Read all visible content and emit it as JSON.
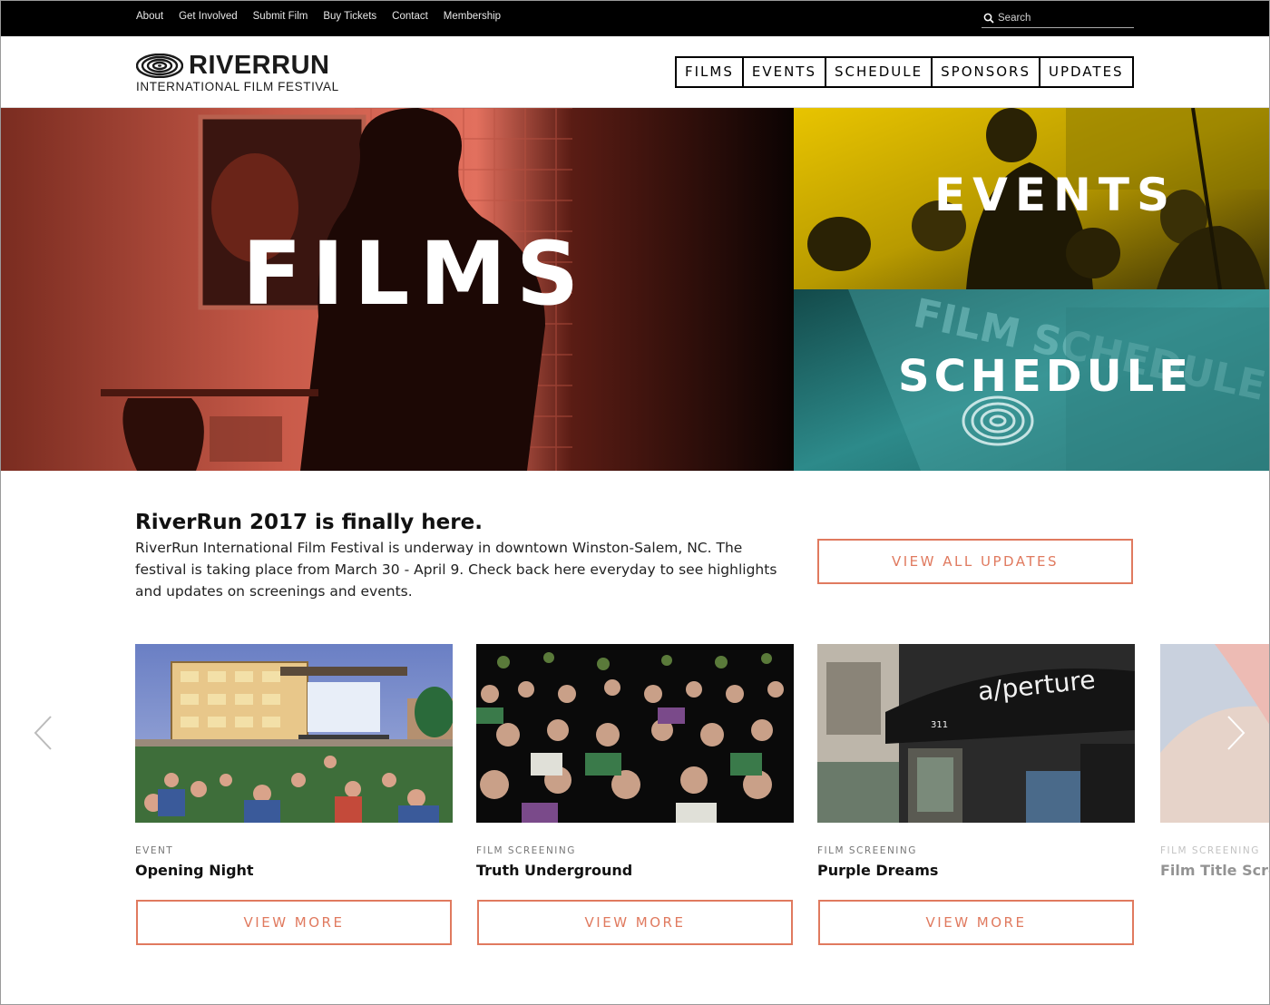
{
  "utility_nav": {
    "links": [
      "About",
      "Get Involved",
      "Submit Film",
      "Buy Tickets",
      "Contact",
      "Membership"
    ],
    "search_placeholder": "Search"
  },
  "header": {
    "logo_name": "RIVERRUN",
    "logo_subtitle": "INTERNATIONAL FILM FESTIVAL",
    "nav": [
      "FILMS",
      "EVENTS",
      "SCHEDULE",
      "SPONSORS",
      "UPDATES"
    ]
  },
  "hero": {
    "films_label": "FILMS",
    "events_label": "EVENTS",
    "schedule_label": "SCHEDULE",
    "schedule_photo_text": "FILM SCHEDULE"
  },
  "intro": {
    "title": "RiverRun 2017 is finally here.",
    "body": "RiverRun International Film Festival is underway in downtown Winston-Salem, NC. The festival is taking place from March 30 - April 9. Check back here everyday to see highlights and updates on screenings and events.",
    "button_label": "VIEW ALL UPDATES"
  },
  "cards": [
    {
      "category": "EVENT",
      "title": "Opening Night",
      "button_label": "VIEW MORE"
    },
    {
      "category": "FILM SCREENING",
      "title": "Truth Underground",
      "button_label": "VIEW MORE"
    },
    {
      "category": "FILM SCREENING",
      "title": "Purple Dreams",
      "button_label": "VIEW MORE",
      "photo_sign": "a/perture",
      "photo_number": "311"
    },
    {
      "category": "FILM SCREENING",
      "title": "Film Title Screening"
    }
  ],
  "colors": {
    "accent": "#e07a5f",
    "films_tint": "#e2705e",
    "events_tint": "#e8c400",
    "schedule_tint": "#2d8a8a"
  },
  "icons": {
    "search": "search-icon",
    "prev": "chevron-left-icon",
    "next": "chevron-right-icon"
  }
}
